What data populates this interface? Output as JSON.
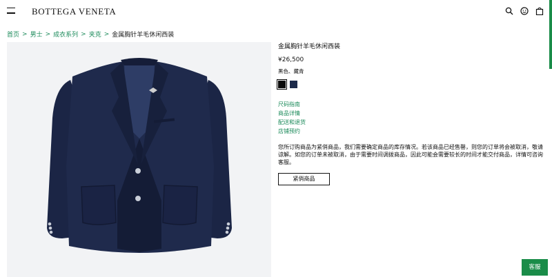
{
  "header": {
    "brand": "BOTTEGA VENETA",
    "icons": [
      "menu-icon",
      "search-icon",
      "account-icon",
      "shopping-bag-icon"
    ]
  },
  "breadcrumb": {
    "items": [
      "首页",
      "男士",
      "成衣系列",
      "夹克"
    ],
    "separator": ">",
    "current": "金属胸针羊毛休闲西装"
  },
  "product": {
    "title": "金属胸针羊毛休闲西装",
    "price": "¥26,500",
    "colors": "黑色、藏青",
    "swatches": [
      {
        "name": "black",
        "color": "#0a0a0a"
      },
      {
        "name": "navy",
        "color": "#1d2a4a"
      }
    ]
  },
  "links": {
    "size_guide": "尺码指南",
    "details": "商品详情",
    "delivery": "配送和退货",
    "store_booking": "店铺预约"
  },
  "notice": "您所订购商品为紧俏商品，我们需要确定商品的库存情况。若该商品已经售罄，则您的订单将会被取消，敬请谅解。如您的订单未被取消，由于需要时间调拨商品，因此可能会需要较长的时间才能交付商品，详情可咨询客服。",
  "actions": {
    "urgent_label": "紧俏商品",
    "service_label": "客服"
  },
  "colors": {
    "accent_green": "#1a8c49",
    "link_green": "#1b8a5a",
    "jacket_navy": "#1d2a4a"
  }
}
